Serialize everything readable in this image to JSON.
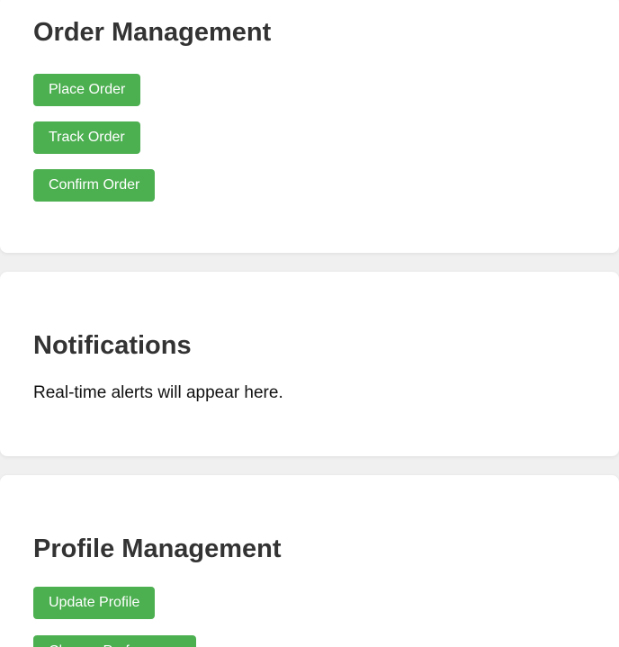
{
  "colors": {
    "button_bg": "#4caf50",
    "button_text": "#ffffff",
    "heading": "#333333",
    "page_bg": "#f0f0f0",
    "card_bg": "#ffffff"
  },
  "order_management": {
    "title": "Order Management",
    "buttons": [
      "Place Order",
      "Track Order",
      "Confirm Order"
    ]
  },
  "notifications": {
    "title": "Notifications",
    "message": "Real-time alerts will appear here."
  },
  "profile_management": {
    "title": "Profile Management",
    "buttons": [
      "Update Profile",
      "Change Preferences"
    ]
  }
}
